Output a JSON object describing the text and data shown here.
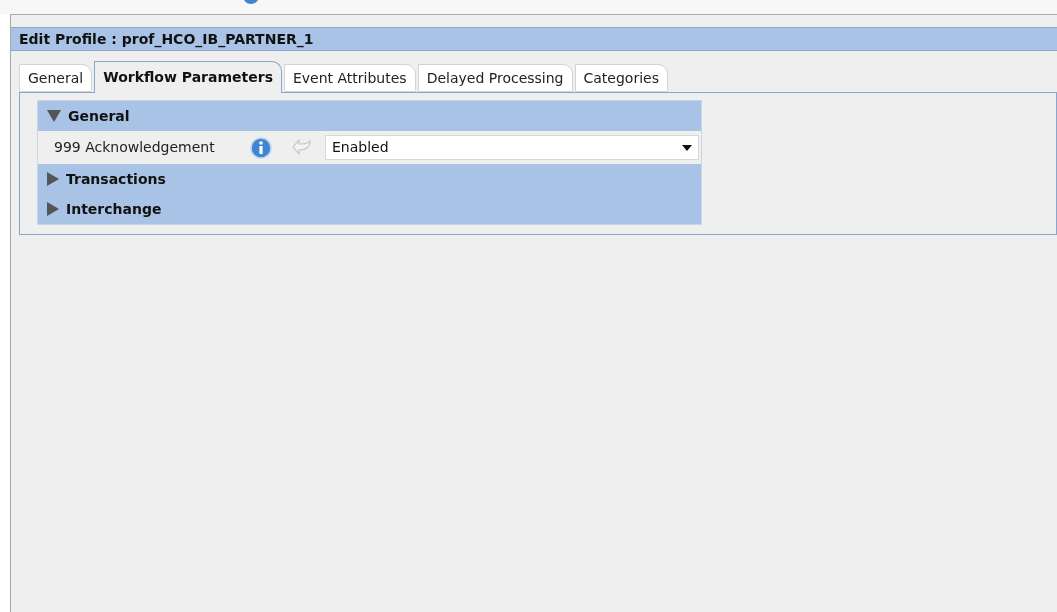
{
  "window": {
    "title": "Edit Profile : prof_HCO_IB_PARTNER_1"
  },
  "tabs": [
    {
      "label": "General",
      "selected": false
    },
    {
      "label": "Workflow Parameters",
      "selected": true
    },
    {
      "label": "Event Attributes",
      "selected": false
    },
    {
      "label": "Delayed Processing",
      "selected": false
    },
    {
      "label": "Categories",
      "selected": false
    }
  ],
  "sections": [
    {
      "title": "General",
      "expanded": true,
      "fields": [
        {
          "label": "999 Acknowledgement",
          "value": "Enabled"
        }
      ]
    },
    {
      "title": "Transactions",
      "expanded": false
    },
    {
      "title": "Interchange",
      "expanded": false
    }
  ]
}
